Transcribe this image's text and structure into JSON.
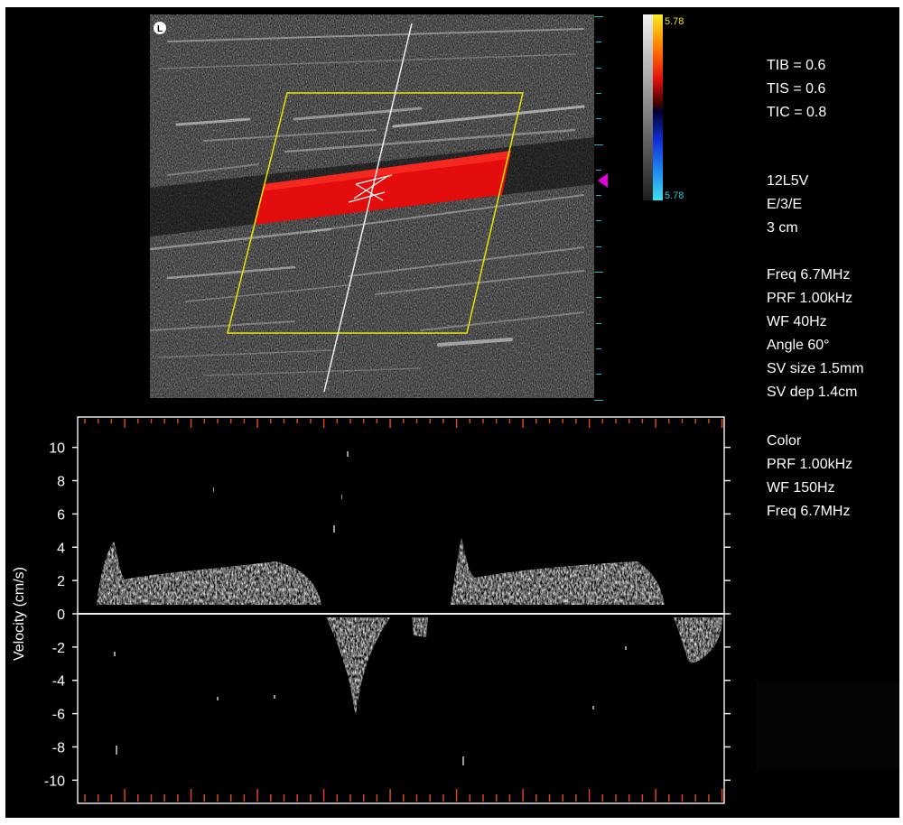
{
  "colorbar": {
    "top_value": "5.78",
    "bottom_value": "5.78",
    "top_color": "#f2e61a",
    "bottom_color": "#28c8e0"
  },
  "info": {
    "thermal": [
      "TIB = 0.6",
      "TIS = 0.6",
      "TIC = 0.8"
    ],
    "probe": [
      "12L5V",
      "E/3/E",
      "3 cm"
    ],
    "pw": [
      "Freq 6.7MHz",
      "PRF 1.00kHz",
      "WF 40Hz",
      "Angle 60°",
      "SV size 1.5mm",
      "SV dep 1.4cm"
    ],
    "color": [
      "Color",
      "PRF 1.00kHz",
      "WF 150Hz",
      "Freq 6.7MHz"
    ]
  },
  "doppler": {
    "ylabel": "Velocity (cm/s)",
    "ylim": [
      -11.5,
      11.5
    ],
    "ticks": [
      "10",
      "8",
      "6",
      "4",
      "2",
      "0",
      "-2",
      "-4",
      "-6",
      "-8",
      "-10"
    ],
    "tick_values": [
      10,
      8,
      6,
      4,
      2,
      0,
      -2,
      -4,
      -6,
      -8,
      -10
    ]
  },
  "colors": {
    "flow": "#e40d0d",
    "roi_box": "#e6e600",
    "depth_marker": "#e100e1",
    "frame": "#e8e8e8",
    "time_ticks": "#d84818"
  },
  "icons": {
    "orientation": "probe-orientation-icon",
    "depth_marker": "focus-marker-triangle-icon"
  }
}
